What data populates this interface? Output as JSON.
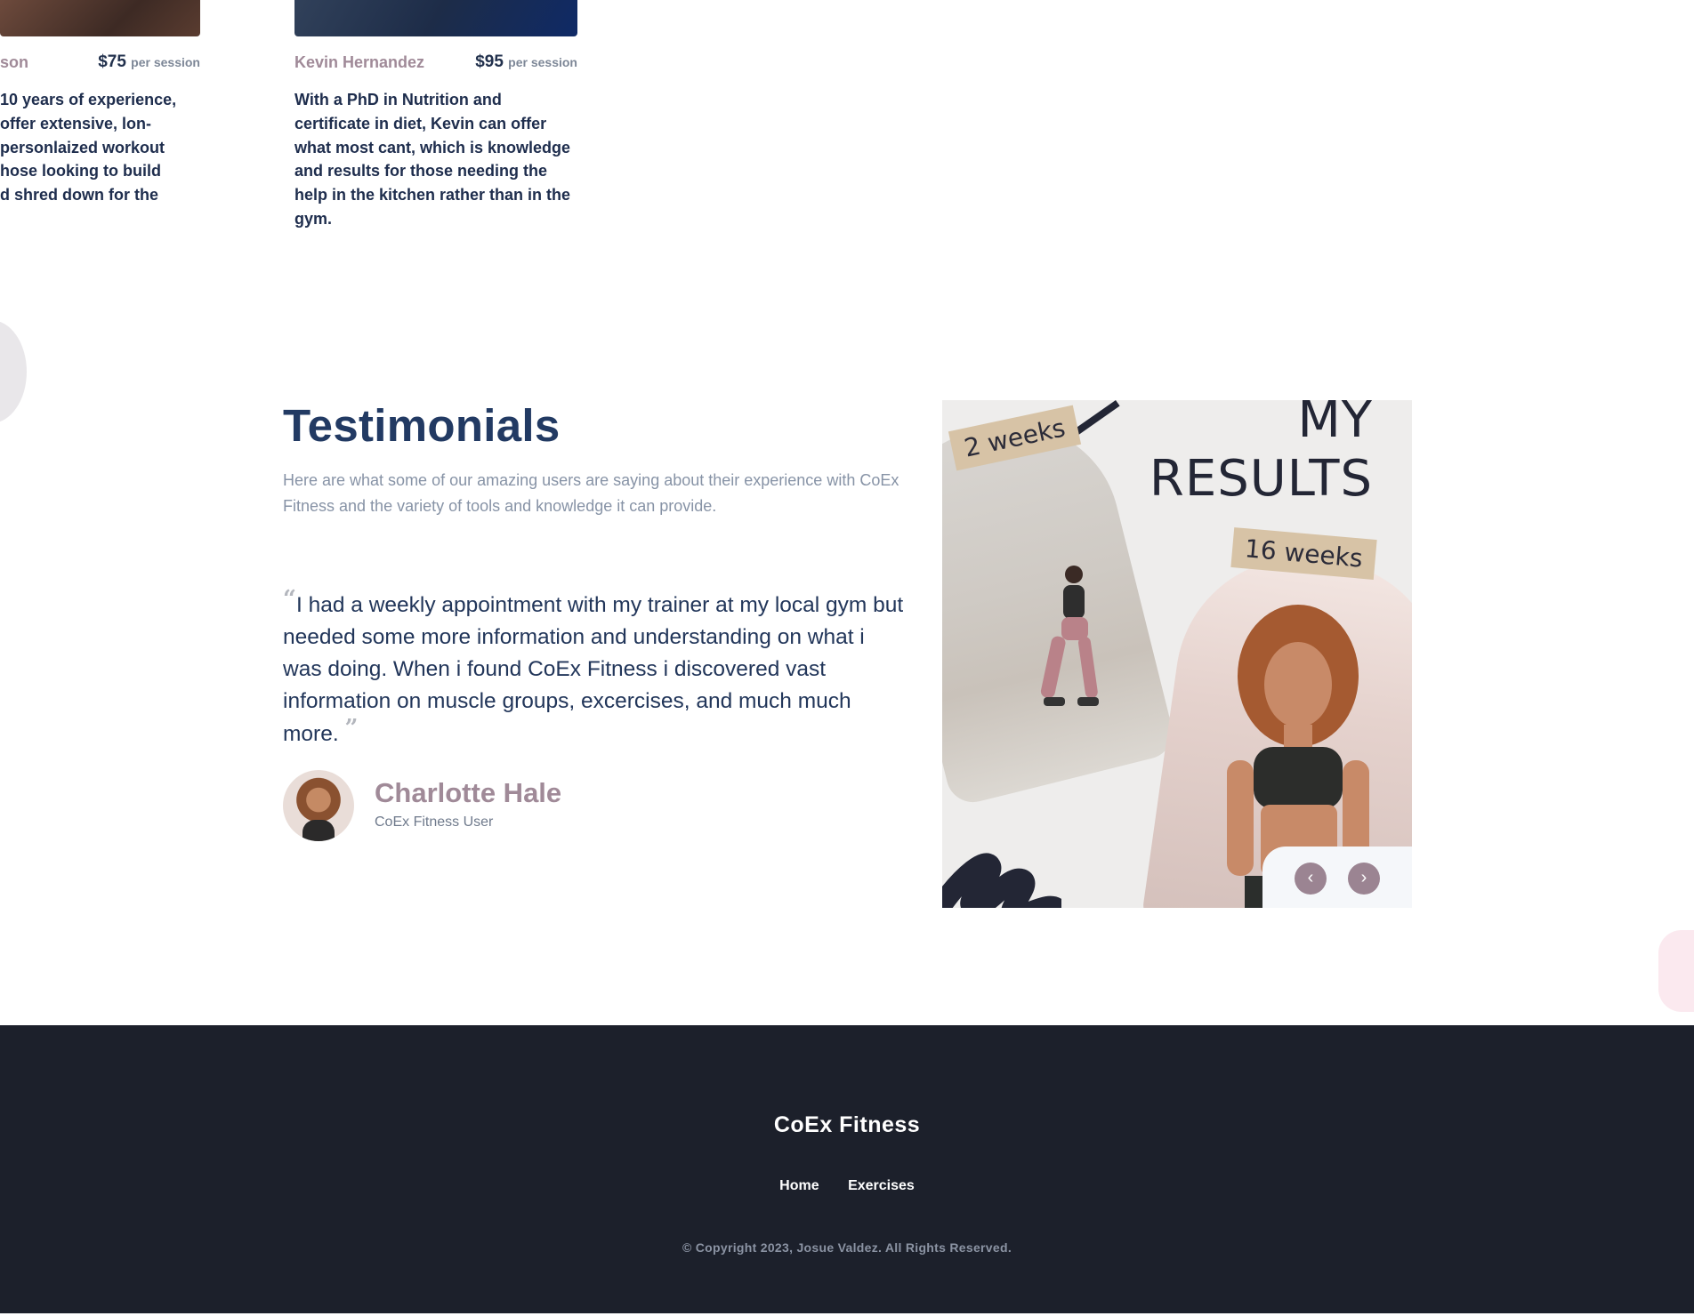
{
  "trainers": [
    {
      "name": "son",
      "price": "$75",
      "per": "per session",
      "description_lines": [
        "10 years of experience,",
        " offer extensive, lon-",
        "personlaized workout",
        "hose looking to build",
        "d shred down for the"
      ]
    },
    {
      "name": "Kevin Hernandez",
      "price": "$95",
      "per": "per session",
      "description_lines": [
        "With a PhD in Nutrition and",
        "certificate in diet, Kevin can offer",
        "what most cant, which is knowledge",
        "and results for those needing the",
        "help in the kitchen rather than in the",
        "gym."
      ]
    }
  ],
  "testimonials": {
    "title": "Testimonials",
    "subtitle": "Here are what some of our amazing users are saying about their experience with CoEx Fitness and the variety of tools and knowledge it can provide.",
    "quote_open": "“",
    "quote_close": "”",
    "quote": "I had a weekly appointment with my trainer at my local gym but needed some more information and understanding on what i was doing. When i found CoEx Fitness i discovered vast information on muscle groups, excercises, and much much more.",
    "author": "Charlotte Hale",
    "role": "CoEx Fitness User"
  },
  "results_image": {
    "heading_line1": "MY",
    "heading_line2": "RESULTS",
    "tag_before": "2 weeks",
    "tag_after": "16 weeks",
    "prev_icon": "‹",
    "next_icon": "›"
  },
  "footer": {
    "brand": "CoEx Fitness",
    "nav": [
      "Home",
      "Exercises"
    ],
    "copyright": "© Copyright 2023, Josue Valdez. All Rights Reserved."
  },
  "colors": {
    "heading": "#223a63",
    "accent_muted": "#a08a98",
    "footer_bg": "#1c202b"
  }
}
